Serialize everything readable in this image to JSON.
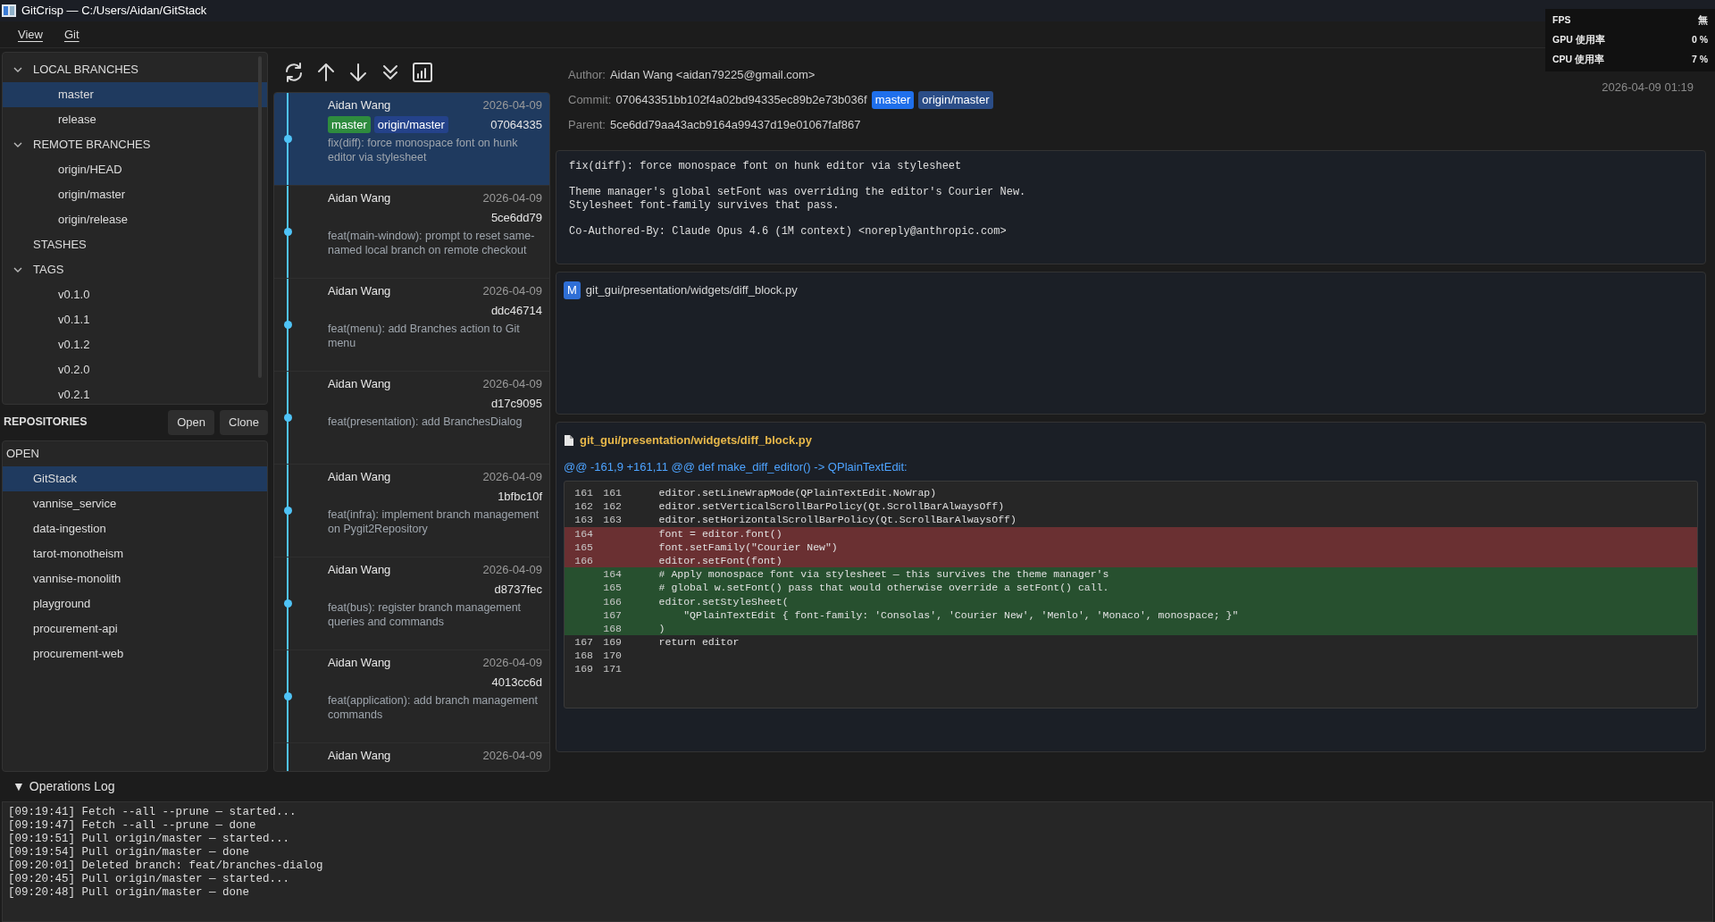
{
  "window": {
    "title": "GitCrisp — C:/Users/Aidan/GitStack"
  },
  "menu": [
    "View",
    "Git"
  ],
  "branch_tree": [
    {
      "label": "LOCAL BRANCHES",
      "expanded": true,
      "children": [
        {
          "label": "master",
          "selected": true
        },
        {
          "label": "release",
          "selected": false
        }
      ]
    },
    {
      "label": "REMOTE BRANCHES",
      "expanded": true,
      "children": [
        {
          "label": "origin/HEAD",
          "selected": false
        },
        {
          "label": "origin/master",
          "selected": false
        },
        {
          "label": "origin/release",
          "selected": false
        }
      ]
    },
    {
      "label": "STASHES"
    },
    {
      "label": "TAGS",
      "expanded": true,
      "children": [
        {
          "label": "v0.1.0",
          "selected": false
        },
        {
          "label": "v0.1.1",
          "selected": false
        },
        {
          "label": "v0.1.2",
          "selected": false
        },
        {
          "label": "v0.2.0",
          "selected": false
        },
        {
          "label": "v0.2.1",
          "selected": false
        }
      ]
    }
  ],
  "repositories": {
    "title": "REPOSITORIES",
    "buttons": [
      "Open",
      "Clone"
    ],
    "group": "OPEN",
    "items": [
      {
        "label": "GitStack",
        "selected": true
      },
      {
        "label": "vannise_service",
        "selected": false
      },
      {
        "label": "data-ingestion",
        "selected": false
      },
      {
        "label": "tarot-monotheism",
        "selected": false
      },
      {
        "label": "vannise-monolith",
        "selected": false
      },
      {
        "label": "playground",
        "selected": false
      },
      {
        "label": "procurement-api",
        "selected": false
      },
      {
        "label": "procurement-web",
        "selected": false
      }
    ]
  },
  "commits": [
    {
      "author": "Aidan Wang",
      "date": "2026-04-09",
      "hash": "07064335",
      "refs": [
        {
          "label": "master",
          "kind": "local"
        },
        {
          "label": "origin/master",
          "kind": "remote"
        }
      ],
      "message": "fix(diff): force monospace font on hunk editor via stylesheet",
      "selected": true
    },
    {
      "author": "Aidan Wang",
      "date": "2026-04-09",
      "hash": "5ce6dd79",
      "message": "feat(main-window): prompt to reset same-named local branch on remote checkout",
      "selected": false
    },
    {
      "author": "Aidan Wang",
      "date": "2026-04-09",
      "hash": "ddc46714",
      "message": "feat(menu): add Branches action to Git menu",
      "selected": false
    },
    {
      "author": "Aidan Wang",
      "date": "2026-04-09",
      "hash": "d17c9095",
      "message": "feat(presentation): add BranchesDialog",
      "selected": false
    },
    {
      "author": "Aidan Wang",
      "date": "2026-04-09",
      "hash": "1bfbc10f",
      "message": "feat(infra): implement branch management on Pygit2Repository",
      "selected": false
    },
    {
      "author": "Aidan Wang",
      "date": "2026-04-09",
      "hash": "d8737fec",
      "message": "feat(bus): register branch management queries and commands",
      "selected": false
    },
    {
      "author": "Aidan Wang",
      "date": "2026-04-09",
      "hash": "4013cc6d",
      "message": "feat(application): add branch management commands",
      "selected": false
    },
    {
      "author": "Aidan Wang",
      "date": "2026-04-09",
      "selected": false
    }
  ],
  "detail": {
    "author_label": "Author:",
    "author": "Aidan Wang <aidan79225@gmail.com>",
    "commit_label": "Commit:",
    "commit": "070643351bb102f4a02bd94335ec89b2e73b036f",
    "refs": [
      {
        "label": "master",
        "kind": "local"
      },
      {
        "label": "origin/master",
        "kind": "remote"
      }
    ],
    "parent_label": "Parent:",
    "parent": "5ce6dd79aa43acb9164a99437d19e01067faf867",
    "date": "2026-04-09 01:19"
  },
  "message": [
    "fix(diff): force monospace font on hunk editor via stylesheet",
    "Theme manager's global setFont was overriding the editor's Courier New.\nStylesheet font-family survives that pass.",
    "Co-Authored-By: Claude Opus 4.6 (1M context) <noreply@anthropic.com>"
  ],
  "files": [
    {
      "status": "M",
      "path": "git_gui/presentation/widgets/diff_block.py"
    }
  ],
  "diff": {
    "path": "git_gui/presentation/widgets/diff_block.py",
    "hunk": "@@ -161,9 +161,11 @@ def make_diff_editor() -> QPlainTextEdit:",
    "lines": [
      {
        "kind": "context",
        "old": "161",
        "new": "161",
        "code": "    editor.setLineWrapMode(QPlainTextEdit.NoWrap)"
      },
      {
        "kind": "context",
        "old": "162",
        "new": "162",
        "code": "    editor.setVerticalScrollBarPolicy(Qt.ScrollBarAlwaysOff)"
      },
      {
        "kind": "context",
        "old": "163",
        "new": "163",
        "code": "    editor.setHorizontalScrollBarPolicy(Qt.ScrollBarAlwaysOff)"
      },
      {
        "kind": "del",
        "old": "164",
        "code": "    font = editor.font()"
      },
      {
        "kind": "del",
        "old": "165",
        "code": "    font.setFamily(\"Courier New\")"
      },
      {
        "kind": "del",
        "old": "166",
        "code": "    editor.setFont(font)"
      },
      {
        "kind": "add",
        "new": "164",
        "code": "    # Apply monospace font via stylesheet — this survives the theme manager's"
      },
      {
        "kind": "add",
        "new": "165",
        "code": "    # global w.setFont() pass that would otherwise override a setFont() call."
      },
      {
        "kind": "add",
        "new": "166",
        "code": "    editor.setStyleSheet("
      },
      {
        "kind": "add",
        "new": "167",
        "code": "        \"QPlainTextEdit { font-family: 'Consolas', 'Courier New', 'Menlo', 'Monaco', monospace; }\""
      },
      {
        "kind": "add",
        "new": "168",
        "code": "    )"
      },
      {
        "kind": "context",
        "old": "167",
        "new": "169",
        "code": "    return editor"
      },
      {
        "kind": "context",
        "old": "168",
        "new": "170"
      },
      {
        "kind": "context",
        "old": "169",
        "new": "171"
      }
    ]
  },
  "log": {
    "toggle": "▼",
    "title": "Operations Log",
    "expanded": true,
    "lines": [
      "[09:19:41] Fetch --all --prune — started...",
      "[09:19:47] Fetch --all --prune — done",
      "[09:19:51] Pull origin/master — started...",
      "[09:19:54] Pull origin/master — done",
      "[09:20:01] Deleted branch: feat/branches-dialog",
      "[09:20:45] Pull origin/master — started...",
      "[09:20:48] Pull origin/master — done"
    ]
  },
  "overlay": [
    {
      "label": "FPS",
      "value": "無"
    },
    {
      "label": "GPU 使用率",
      "value": "0 %"
    },
    {
      "label": "CPU 使用率",
      "value": "7 %"
    }
  ]
}
